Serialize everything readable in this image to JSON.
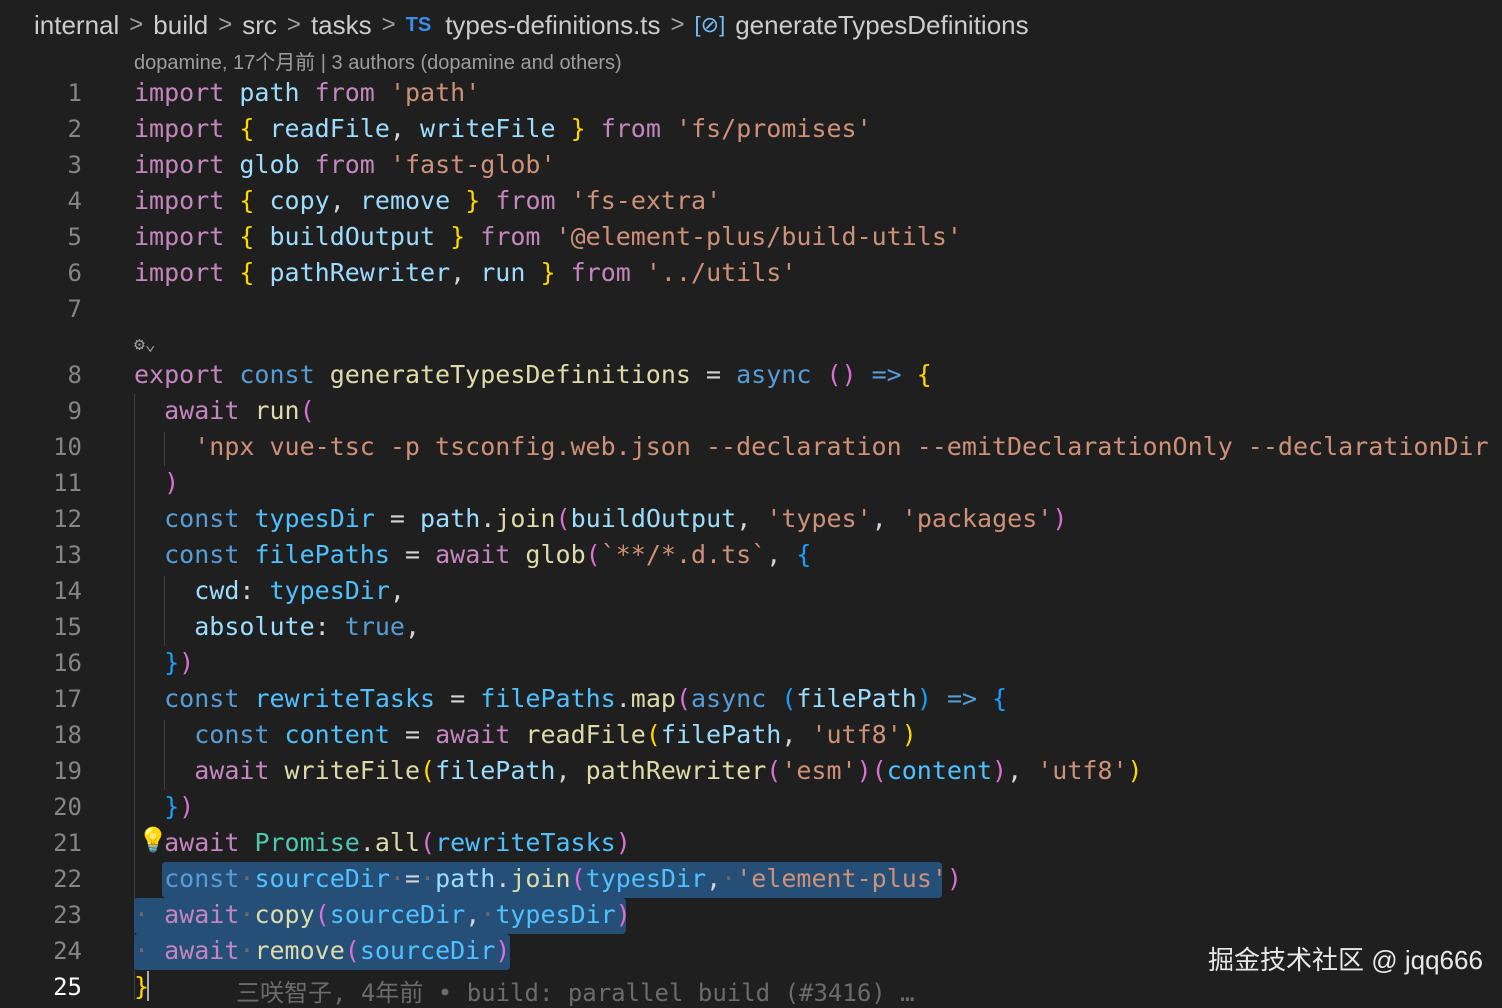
{
  "breadcrumb": {
    "items": [
      "internal",
      "build",
      "src",
      "tasks"
    ],
    "lang_badge": "TS",
    "file": "types-definitions.ts",
    "symbol": "generateTypesDefinitions"
  },
  "blame_header": "dopamine, 17个月前 | 3 authors (dopamine and others)",
  "editor": {
    "line_numbers": [
      "1",
      "2",
      "3",
      "4",
      "5",
      "6",
      "7",
      "8",
      "9",
      "10",
      "11",
      "12",
      "13",
      "14",
      "15",
      "16",
      "17",
      "18",
      "19",
      "20",
      "21",
      "22",
      "23",
      "24",
      "25"
    ],
    "active_line": "25",
    "inline_blame": "三咲智子, 4年前 • build: parallel build (#3416) …"
  },
  "watermark": "掘金技术社区 @ jqq666",
  "colors": {
    "background": "#1f1f1f",
    "selection": "#264f78",
    "keyword": "#c586c0",
    "string": "#ce9178",
    "function": "#dcdcaa"
  }
}
